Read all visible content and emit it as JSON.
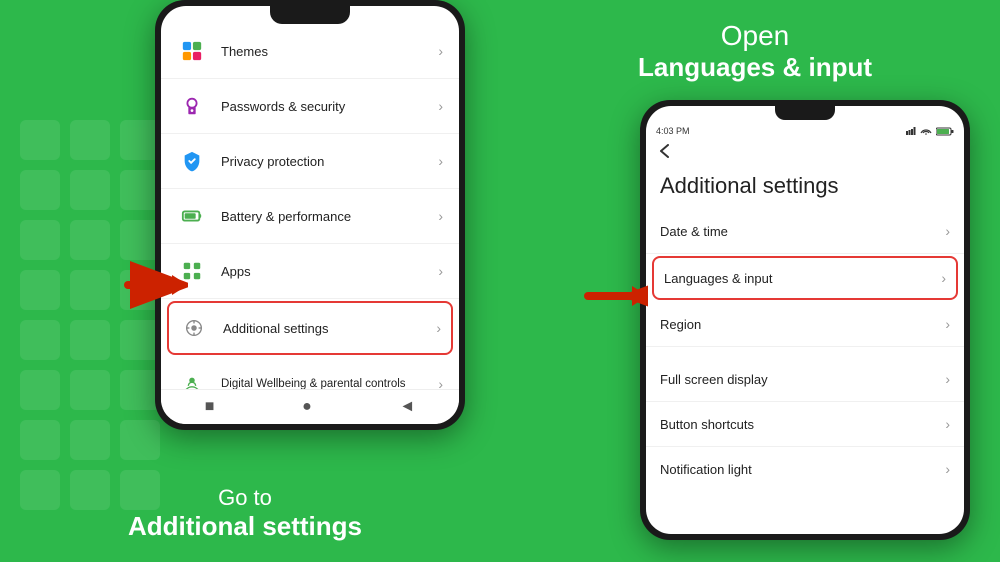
{
  "background_color": "#2db84b",
  "left_phone": {
    "settings_items": [
      {
        "id": "themes",
        "label": "Themes",
        "icon": "🎨",
        "icon_color": "#2196F3",
        "highlighted": false
      },
      {
        "id": "passwords",
        "label": "Passwords & security",
        "icon": "🔒",
        "icon_color": "#9C27B0",
        "highlighted": false
      },
      {
        "id": "privacy",
        "label": "Privacy protection",
        "icon": "🛡",
        "icon_color": "#2196F3",
        "highlighted": false
      },
      {
        "id": "battery",
        "label": "Battery & performance",
        "icon": "🔋",
        "icon_color": "#4CAF50",
        "highlighted": false
      },
      {
        "id": "apps",
        "label": "Apps",
        "icon": "📱",
        "icon_color": "#4CAF50",
        "highlighted": false
      },
      {
        "id": "additional",
        "label": "Additional settings",
        "icon": "⚙",
        "icon_color": "#888",
        "highlighted": true
      },
      {
        "id": "wellbeing",
        "label": "Digital Wellbeing & parental controls",
        "icon": "🌱",
        "icon_color": "#4CAF50",
        "highlighted": false
      }
    ],
    "bottom_nav": [
      "■",
      "●",
      "◄"
    ]
  },
  "left_text": {
    "line1": "Go to",
    "line2": "Additional settings"
  },
  "right_text": {
    "line1": "Open",
    "line2": "Languages & input"
  },
  "right_phone": {
    "status_bar": {
      "time": "4:03 PM",
      "icons": "📶🔋"
    },
    "back_label": "←",
    "page_title": "Additional settings",
    "list_items": [
      {
        "id": "date-time",
        "label": "Date & time",
        "highlighted": false
      },
      {
        "id": "languages",
        "label": "Languages & input",
        "highlighted": true
      },
      {
        "id": "region",
        "label": "Region",
        "highlighted": false
      },
      {
        "id": "fullscreen",
        "label": "Full screen display",
        "highlighted": false
      },
      {
        "id": "button-shortcuts",
        "label": "Button shortcuts",
        "highlighted": false
      },
      {
        "id": "notification-light",
        "label": "Notification light",
        "highlighted": false
      }
    ]
  }
}
